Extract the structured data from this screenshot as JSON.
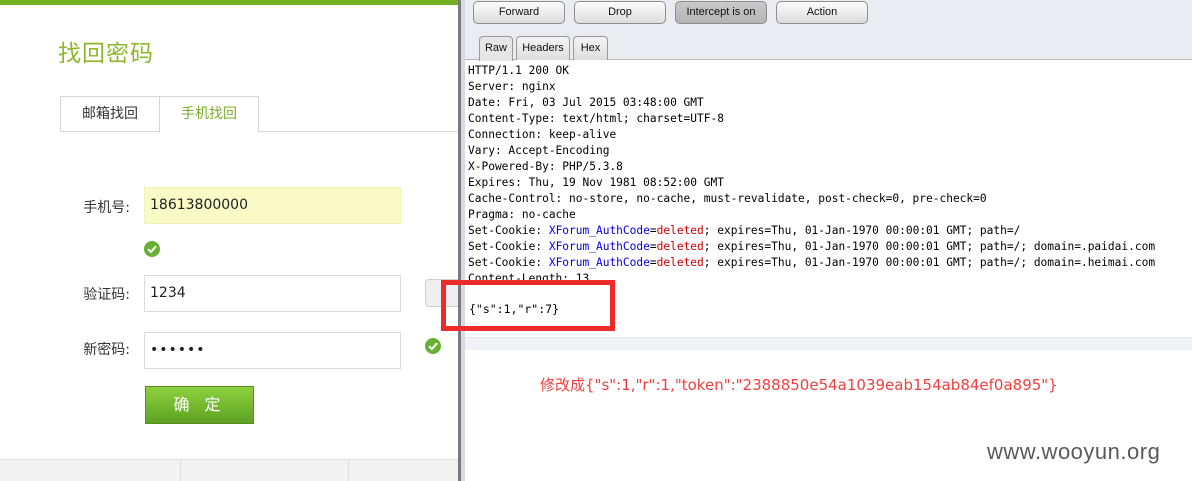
{
  "left": {
    "title": "找回密码",
    "tabs": [
      {
        "label": "邮箱找回",
        "active": false
      },
      {
        "label": "手机找回",
        "active": true
      }
    ],
    "form": {
      "phone_label": "手机号:",
      "phone_value": "18613800000",
      "captcha_label": "验证码:",
      "captcha_value": "1234",
      "password_label": "新密码:",
      "password_value": "••••••",
      "confirm_label": "确 定"
    }
  },
  "burp": {
    "toolbar": {
      "forward": "Forward",
      "drop": "Drop",
      "intercept": "Intercept is on",
      "action": "Action"
    },
    "tabs": [
      "Raw",
      "Headers",
      "Hex"
    ],
    "response_lines": [
      "HTTP/1.1 200 OK",
      "Server: nginx",
      "Date: Fri, 03 Jul 2015 03:48:00 GMT",
      "Content-Type: text/html; charset=UTF-8",
      "Connection: keep-alive",
      "Vary: Accept-Encoding",
      "X-Powered-By: PHP/5.3.8",
      "Expires: Thu, 19 Nov 1981 08:52:00 GMT",
      "Cache-Control: no-store, no-cache, must-revalidate, post-check=0, pre-check=0",
      "Pragma: no-cache"
    ],
    "cookie_prefix": "Set-Cookie: ",
    "cookie_name": "XForum_AuthCode",
    "cookie_eq": "=",
    "cookie_value": "deleted",
    "cookie_suffixes": [
      "; expires=Thu, 01-Jan-1970 00:00:01 GMT; path=/",
      "; expires=Thu, 01-Jan-1970 00:00:01 GMT; path=/; domain=.paidai.com",
      "; expires=Thu, 01-Jan-1970 00:00:01 GMT; path=/; domain=.heimai.com"
    ],
    "partial_line": "Content-Length: 13",
    "response_body": "{\"s\":1,\"r\":7}",
    "note": "修改成{\"s\":1,\"r\":1,\"token\":\"2388850e54a1039eab154ab84ef0a895\"}",
    "watermark": "www.wooyun.org"
  }
}
